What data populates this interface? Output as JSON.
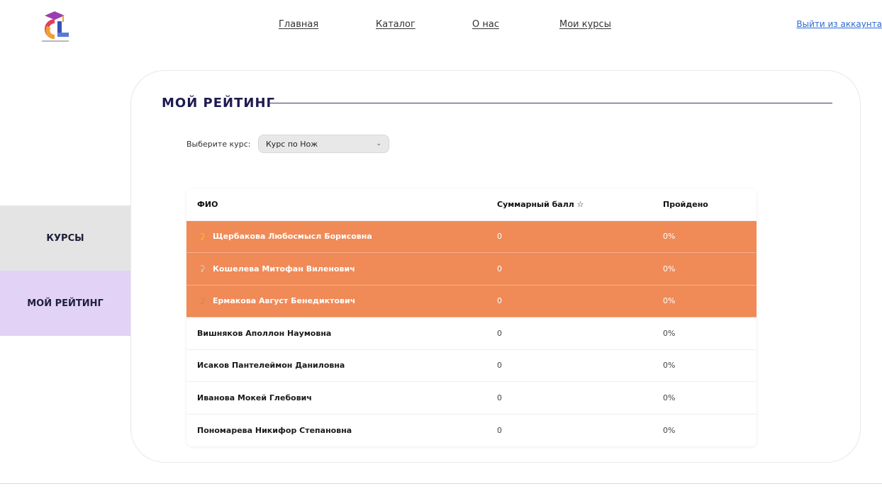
{
  "header": {
    "logo_icon": "graduation-cap-cl-logo",
    "nav": [
      "Главная",
      "Каталог",
      "О нас",
      "Мои курсы"
    ],
    "logout": "Выйти из аккаунта"
  },
  "sidebar": {
    "items": [
      {
        "label": "КУРСЫ"
      },
      {
        "label": "МОЙ РЕЙТИНГ"
      }
    ]
  },
  "main": {
    "title": "МОЙ РЕЙТИНГ",
    "course_select": {
      "label": "Выберите курс:",
      "value": "Курс по Нож"
    },
    "table": {
      "headers": [
        "ФИО",
        "Суммарный балл ☆",
        "Пройдено"
      ],
      "rows": [
        {
          "name": "Щербакова Любосмысл Борисовна",
          "score": "0",
          "done": "0%"
        },
        {
          "name": "Кошелева Митофан Виленович",
          "score": "0",
          "done": "0%"
        },
        {
          "name": "Ермакова Август Бенедиктович",
          "score": "0",
          "done": "0%"
        },
        {
          "name": "Вишняков Аполлон Наумовна",
          "score": "0",
          "done": "0%"
        },
        {
          "name": "Исаков Пантелеймон Даниловна",
          "score": "0",
          "done": "0%"
        },
        {
          "name": "Иванова Мокей Глебович",
          "score": "0",
          "done": "0%"
        },
        {
          "name": "Пономарева Никифор Степановна",
          "score": "0",
          "done": "0%"
        }
      ]
    }
  },
  "colors": {
    "accent_orange": "#f08a57",
    "sidebar_active": "#e2d2f5",
    "sidebar_inactive": "#e4e4e4",
    "link_blue": "#2d6bd1"
  }
}
